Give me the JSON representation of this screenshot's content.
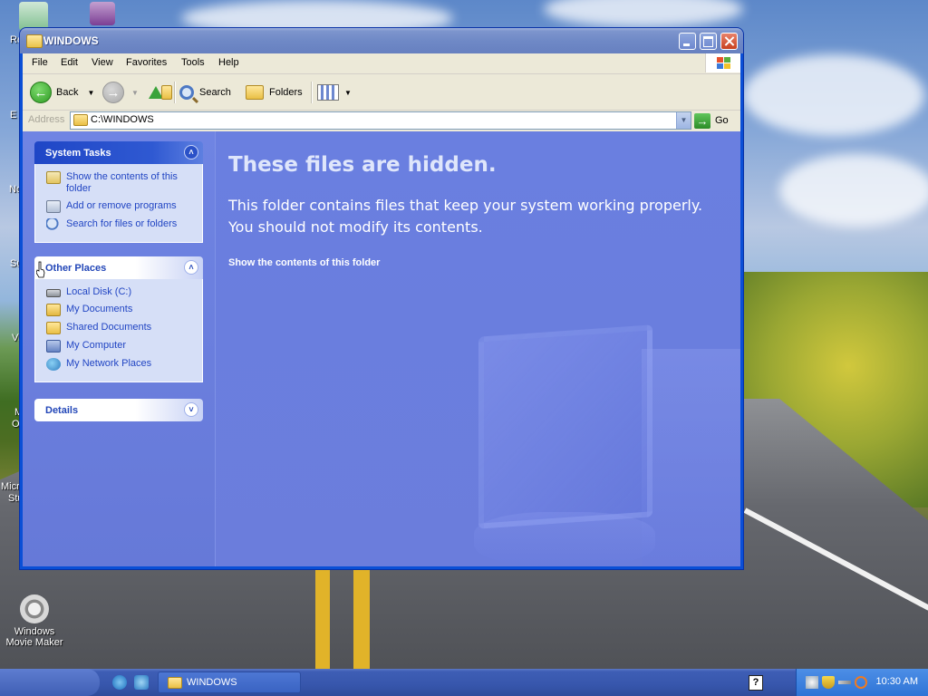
{
  "desktop": {
    "icons": [
      {
        "label": "Windows Movie Maker"
      }
    ],
    "partial_labels": [
      "Re",
      "E",
      "Nc",
      "Su",
      "Vi",
      "M",
      "O",
      "Micr",
      "Stu"
    ]
  },
  "window": {
    "title": "WINDOWS",
    "menu": [
      "File",
      "Edit",
      "View",
      "Favorites",
      "Tools",
      "Help"
    ],
    "toolbar": {
      "back": "Back",
      "search": "Search",
      "folders": "Folders"
    },
    "address": {
      "label": "Address",
      "value": "C:\\WINDOWS",
      "go": "Go"
    },
    "system_tasks": {
      "title": "System Tasks",
      "items": [
        {
          "label": "Show the contents of this folder",
          "icon": "folder-tasks-icon"
        },
        {
          "label": "Add or remove programs",
          "icon": "programs-icon"
        },
        {
          "label": "Search for files or folders",
          "icon": "search-icon"
        }
      ]
    },
    "other_places": {
      "title": "Other Places",
      "items": [
        {
          "label": "Local Disk (C:)",
          "icon": "drive-icon"
        },
        {
          "label": "My Documents",
          "icon": "documents-icon"
        },
        {
          "label": "Shared Documents",
          "icon": "folder-icon"
        },
        {
          "label": "My Computer",
          "icon": "computer-icon"
        },
        {
          "label": "My Network Places",
          "icon": "network-icon"
        }
      ]
    },
    "details": {
      "title": "Details"
    },
    "main": {
      "heading": "These files are hidden.",
      "line1": "This folder contains files that keep your system working properly.",
      "line2": "You should not modify its contents.",
      "link": "Show the contents of this folder"
    }
  },
  "taskbar": {
    "task": "WINDOWS",
    "clock": "10:30 AM",
    "help_glyph": "?"
  },
  "colors": {
    "title_bar": "#7d95cd",
    "pane_bg": "#6a7fe0",
    "link": "#2145c3",
    "taskbar": "#3756ac"
  }
}
